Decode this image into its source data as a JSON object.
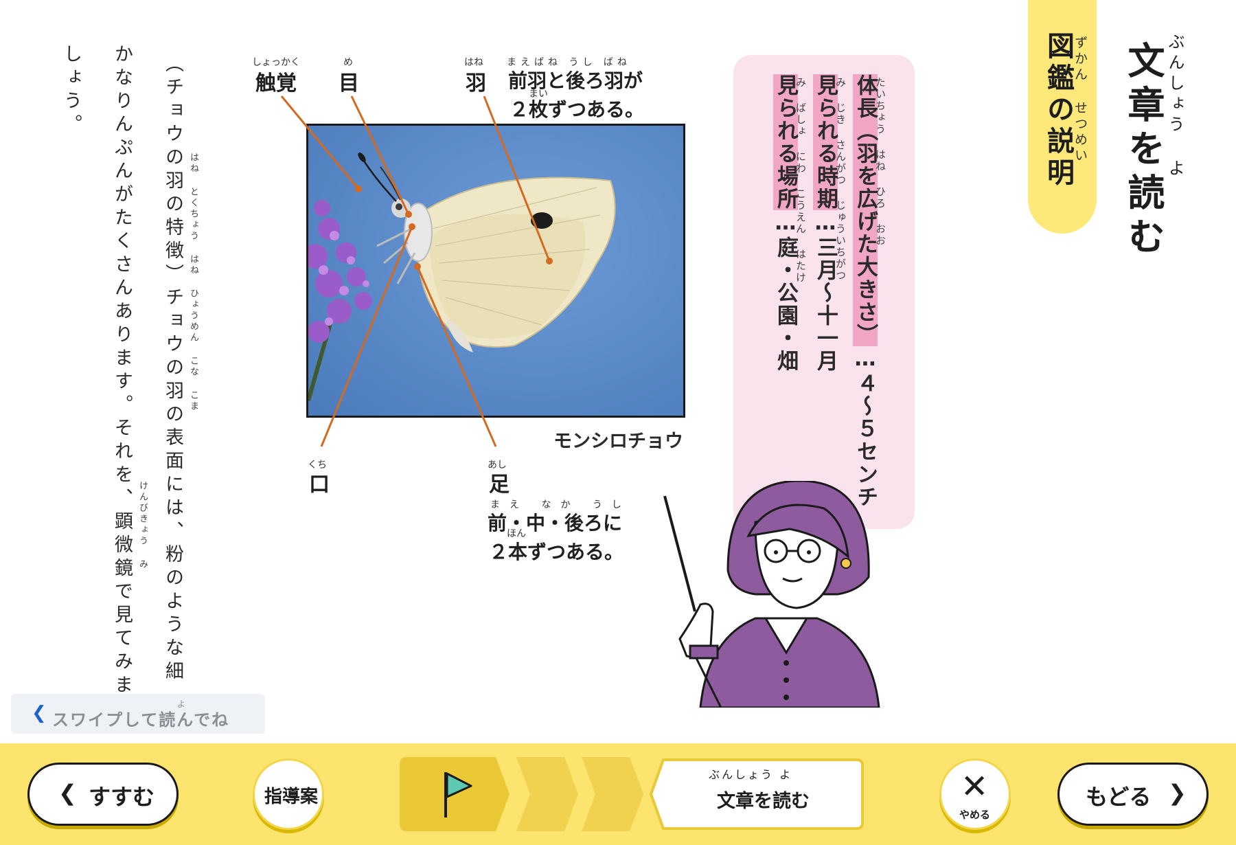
{
  "title": {
    "text": "文章を読む",
    "ruby": "ぶんしょう よ"
  },
  "zukan": {
    "text": "図鑑の説明",
    "ruby": "ずかん せつめい"
  },
  "info": {
    "line1_hl": "体長（羽を広げた大きさ）",
    "line1_rest": "…４～５センチ",
    "line1_ruby": "たいちょう はね ひろ おお",
    "line2_hl": "見られる時期",
    "line2_rest": "…三月～十一月",
    "line2_ruby": "み じき さんがつ じゅういちがつ",
    "line3_hl": "見られる場所",
    "line3_rest": "…庭・公園・畑",
    "line3_ruby": "み ばしょ にわ こうえん はたけ"
  },
  "labels": {
    "antenna": "触覚",
    "antenna_ruby": "しょっかく",
    "eye": "目",
    "eye_ruby": "め",
    "wing": "羽",
    "wing_ruby": "はね",
    "wing_desc_1": "前羽と後ろ羽が",
    "wing_desc_1_ruby": "まえばね うし ばね",
    "wing_desc_2": "２枚ずつある。",
    "wing_desc_2_ruby": "まい",
    "mouth": "口",
    "mouth_ruby": "くち",
    "leg": "足",
    "leg_ruby": "あし",
    "leg_desc_1": "前・中・後ろに",
    "leg_desc_1_ruby": "まえ なか うし",
    "leg_desc_2": "２本ずつある。",
    "leg_desc_2_ruby": "ほん",
    "caption": "モンシロチョウ"
  },
  "body": {
    "col1": "（チョウの羽の特徴）チョウの羽の表面には、粉のような細",
    "col1_ruby": "はね とくちょう はね ひょうめん こな こま",
    "col2": "かなりんぷんがたくさんあります。それを、顕微鏡で見てみま",
    "col2_ruby": "けんびきょう み",
    "col3": "しょう。"
  },
  "swipe": {
    "text": "スワイプして読んでね",
    "ruby": "よ"
  },
  "nav": {
    "next": "すすむ",
    "guide": "指導案",
    "current_step": "文章を読む",
    "current_step_ruby": "ぶんしょう よ",
    "quit": "やめる",
    "back": "もどる"
  },
  "colors": {
    "bar": "#fde46e",
    "highlight": "#f2a6c6",
    "panel": "#fbe3ee",
    "flag": "#5ec9b3",
    "accent": "#e06a1b"
  }
}
